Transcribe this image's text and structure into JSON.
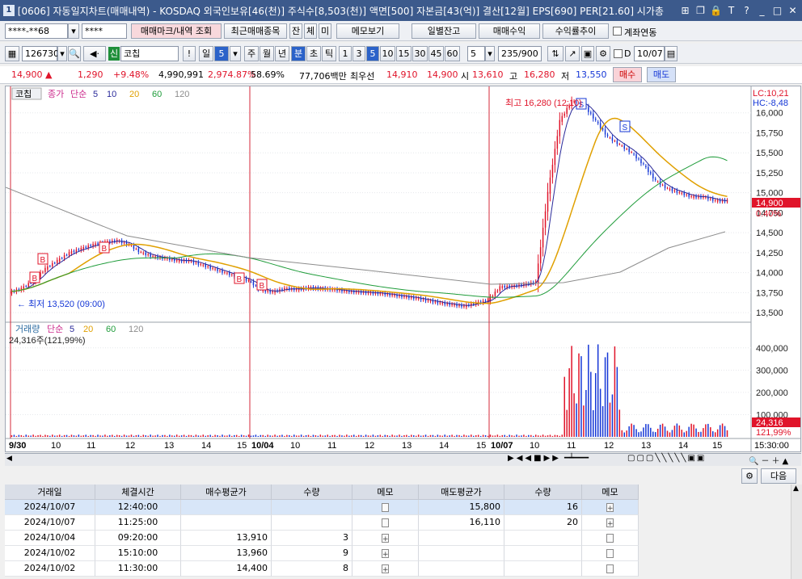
{
  "window": {
    "title": "[0606] 자동일지차트(매매내역) - KOSDAQ 외국인보유[46(천)] 주식수[8,503(천)] 액면[500] 자본금[43(억)] 결산[12월] EPS[690] PER[21.60] 시가총",
    "app_badge": "1",
    "icons": [
      "restore-icon",
      "layout-icon",
      "lock-icon",
      "text-icon",
      "help-icon",
      "minimize-icon",
      "maximize-icon",
      "close-icon"
    ],
    "icon_glyphs": [
      "⊞",
      "❐",
      "🔒",
      "T",
      "?",
      "_",
      "□",
      "✕"
    ]
  },
  "toolbar1": {
    "account_value": "****-**68",
    "password_value": "****",
    "btn_trade_mark": "매매마크/내역 조회",
    "btn_recent": "최근매매종목",
    "btn_jan": "잔",
    "btn_che": "체",
    "btn_mi": "미",
    "btn_memo": "메모보기",
    "btn_daily": "일별잔고",
    "btn_profit": "매매수익",
    "btn_trend": "수익률추이",
    "chk_account_link": "계좌연동"
  },
  "toolbar2": {
    "code": "126730",
    "credit_badge": "신",
    "stock_name": "코칩",
    "excl": "!",
    "period_day": "일",
    "period_day_n": "5",
    "week": "주",
    "month": "월",
    "year": "년",
    "minute": "분",
    "second": "초",
    "tick": "틱",
    "intervals": [
      "1",
      "3",
      "5",
      "10",
      "15",
      "30",
      "45",
      "60"
    ],
    "selected_interval": "5",
    "count_value": "5",
    "range_value": "235",
    "range_total": "/900",
    "d_label": "D",
    "date_value": "10/07"
  },
  "pricebar": {
    "price": "14,900",
    "arrow": "▲",
    "change": "1,290",
    "rate": "+9.48%",
    "volume": "4,990,991",
    "vol_rate": "2,974.87%",
    "turnover": "58.69%",
    "amount": "77,706백만",
    "best_bid_label": "최우선",
    "ask": "14,910",
    "bid": "14,900",
    "open_label": "시",
    "open": "13,610",
    "high_label": "고",
    "high": "16,280",
    "low_label": "저",
    "low": "13,550",
    "buy_btn": "매수",
    "sell_btn": "매도"
  },
  "chart": {
    "tag": "코칩",
    "price_legend": [
      "종가",
      "단순",
      "5",
      "10",
      "20",
      "60",
      "120"
    ],
    "volume_legend": [
      "거래량",
      "단순",
      "5",
      "20",
      "60",
      "120"
    ],
    "volume_now": "24,316주(121,99%)",
    "lc_label": "LC:10,21",
    "hc_label": "HC:-8,48",
    "high_annotation": "최고 16,280 (12:10)",
    "low_annotation": "최저 13,520 (09:00)",
    "last_price_box": "14,900",
    "last_rate_box": "0.40%",
    "last_vol_box": "24,316",
    "last_vol_rate": "121,99%",
    "time_readout": "15:30:00",
    "colors": {
      "up": "#e0142a",
      "down": "#1537d6",
      "ma5": "#2a2a9a",
      "ma20": "#e0a000",
      "ma60": "#1f9c3a",
      "ma120": "#8c8c8c",
      "vline": "#d4283a"
    }
  },
  "chart_data": {
    "type": "candlestick",
    "price_axis": {
      "min": 13500,
      "max": 16000,
      "ticks": [
        "16,000",
        "15,750",
        "15,500",
        "15,250",
        "15,000",
        "14,750",
        "14,500",
        "14,250",
        "14,000",
        "13,750",
        "13,500"
      ]
    },
    "volume_axis": {
      "ticks": [
        "400,000",
        "300,000",
        "200,000",
        "100,000"
      ]
    },
    "x_tick_labels": [
      "9/30",
      "10",
      "11",
      "12",
      "13",
      "14",
      "15",
      "10/04",
      "10",
      "11",
      "12",
      "13",
      "14",
      "15",
      "10/07",
      "10",
      "11",
      "12",
      "13",
      "14",
      "15"
    ],
    "session_dividers": [
      "9/30",
      "10/04",
      "10/07"
    ],
    "trade_markers": [
      {
        "type": "B",
        "date": "9/30"
      },
      {
        "type": "B",
        "date": "9/30"
      },
      {
        "type": "B",
        "date": "10/02"
      },
      {
        "type": "B",
        "date": "10/02"
      },
      {
        "type": "B",
        "date": "10/04"
      },
      {
        "type": "S",
        "date": "10/07"
      },
      {
        "type": "S",
        "date": "10/07"
      }
    ],
    "session_closes": [
      [
        13800,
        13900,
        14050,
        14150,
        14250,
        14300,
        14350,
        14380,
        14400,
        14350,
        14250,
        14200,
        14180,
        14150,
        14150,
        14100,
        14050,
        14000,
        13950,
        13900
      ],
      [
        13780,
        13760,
        13800,
        13790,
        13810,
        13800,
        13790,
        13770,
        13760,
        13750,
        13740,
        13720,
        13700,
        13680,
        13650,
        13620,
        13600,
        13580,
        13620,
        13650
      ],
      [
        13820,
        13830,
        13850,
        13880,
        15000,
        15900,
        16150,
        16100,
        15900,
        15700,
        15600,
        15500,
        15350,
        15150,
        15050,
        15000,
        14950,
        14950,
        14900,
        14900
      ]
    ]
  },
  "panel": {
    "next_btn": "다음",
    "headers": [
      "거래일",
      "체결시간",
      "매수평균가",
      "수량",
      "메모",
      "매도평균가",
      "수량",
      "메모"
    ],
    "rows": [
      {
        "date": "2024/10/07",
        "time": "12:40:00",
        "buy_avg": "",
        "buy_qty": "",
        "sell_avg": "15,800",
        "sell_qty": "16",
        "selected": true
      },
      {
        "date": "2024/10/07",
        "time": "11:25:00",
        "buy_avg": "",
        "buy_qty": "",
        "sell_avg": "16,110",
        "sell_qty": "20",
        "selected": false
      },
      {
        "date": "2024/10/04",
        "time": "09:20:00",
        "buy_avg": "13,910",
        "buy_qty": "3",
        "sell_avg": "",
        "sell_qty": "",
        "selected": false
      },
      {
        "date": "2024/10/02",
        "time": "15:10:00",
        "buy_avg": "13,960",
        "buy_qty": "9",
        "sell_avg": "",
        "sell_qty": "",
        "selected": false
      },
      {
        "date": "2024/10/02",
        "time": "11:30:00",
        "buy_avg": "14,400",
        "buy_qty": "8",
        "sell_avg": "",
        "sell_qty": "",
        "selected": false
      }
    ]
  }
}
